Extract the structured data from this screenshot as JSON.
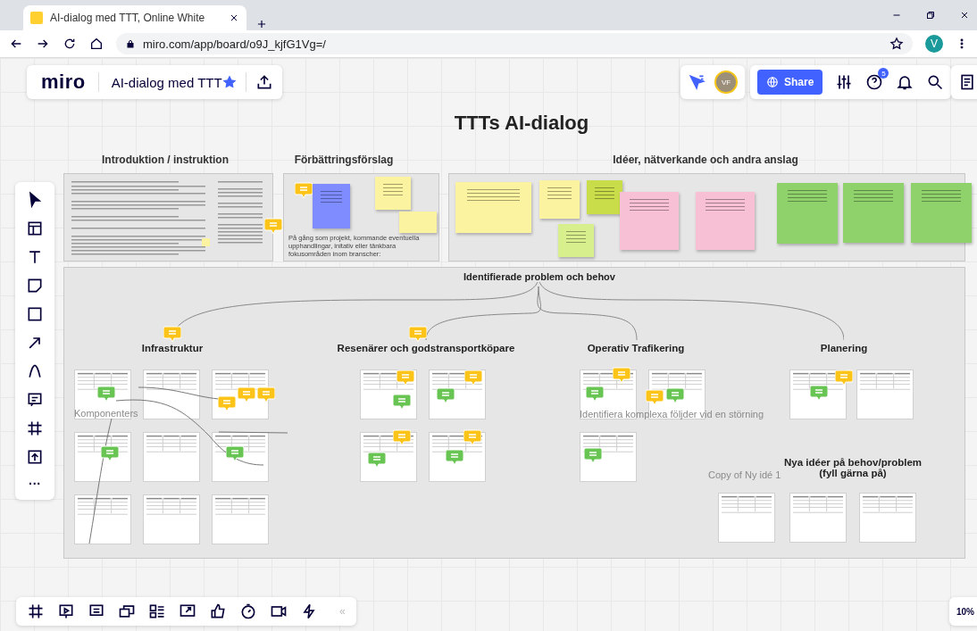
{
  "browser": {
    "tab_title": "AI-dialog med TTT, Online White",
    "url": "miro.com/app/board/o9J_kjfG1Vg=/",
    "profile": "V"
  },
  "app": {
    "logo": "miro",
    "board_name": "AI-dialog med TTT",
    "starred": true,
    "user_initials": "VF",
    "share": "Share",
    "help_badge": "5",
    "zoom": "10%",
    "collapse": "«",
    "more": "···"
  },
  "board": {
    "title": "TTTs AI-dialog",
    "frames": [
      {
        "title": "Introduktion / instruktion"
      },
      {
        "title": "Förbättringsförslag",
        "text": "På gång som projekt, kommande eventuella upphandlingar, initativ eller tänkbara fokusområden inom branscher:"
      },
      {
        "title": "Idéer, nätverkande och andra anslag"
      }
    ],
    "notes": [
      {
        "color": "#fbf3a0"
      },
      {
        "color": "#fbf3a0"
      },
      {
        "color": "#c9dc4a"
      },
      {
        "color": "#d8ef8e"
      },
      {
        "color": "#f8c0d4"
      },
      {
        "color": "#f8c0d4"
      },
      {
        "color": "#8fd16a"
      },
      {
        "color": "#8fd16a"
      },
      {
        "color": "#8fd16a"
      },
      {
        "color": "#7f8cff"
      },
      {
        "color": "#fbf3a0"
      },
      {
        "color": "#fbf3a0"
      }
    ],
    "problems": {
      "title": "Identifierade problem och behov",
      "groups": [
        {
          "title": "Infrastruktur"
        },
        {
          "title": "Resenärer och godstransportköpare"
        },
        {
          "title": "Operativ Trafikering"
        },
        {
          "title": "Planering"
        },
        {
          "title": "Nya idéer på behov/problem\n(fyll gärna på)"
        }
      ],
      "faint_labels": [
        "Komponenters",
        "Identifiera komplexa följder vid en störning",
        "Copy of Ny idé 1"
      ]
    }
  }
}
